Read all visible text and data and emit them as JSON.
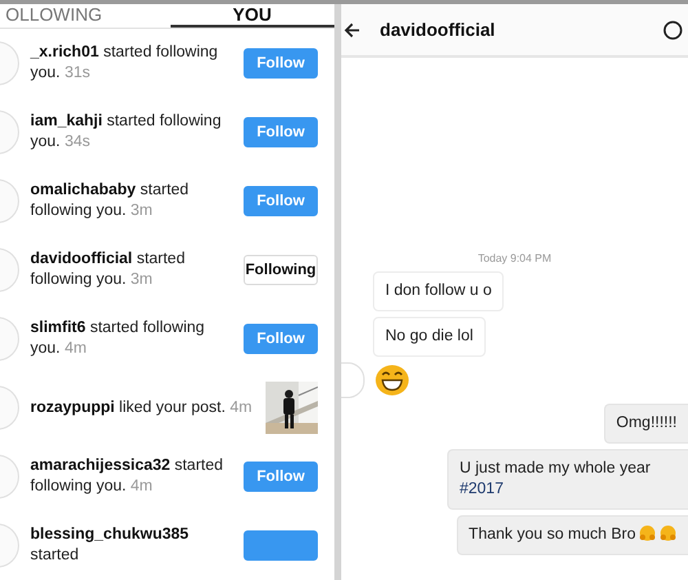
{
  "activity": {
    "tabs": [
      {
        "label": "OLLOWING",
        "selected": false
      },
      {
        "label": "YOU",
        "selected": true
      }
    ],
    "rows": [
      {
        "text": "**_x.rich01** started following you.",
        "time": "31s",
        "kind": "follow",
        "button": {
          "label": "Follow",
          "following": false
        }
      },
      {
        "text": "**iam_kahji** started following you.",
        "time": "34s",
        "kind": "follow",
        "button": {
          "label": "Follow",
          "following": false
        }
      },
      {
        "text": "**omalichababy** started following you.",
        "time": "3m",
        "kind": "follow",
        "button": {
          "label": "Follow",
          "following": false
        }
      },
      {
        "text": "**davidoofficial** started following you.",
        "time": "3m",
        "kind": "follow",
        "button": {
          "label": "Following",
          "following": true
        }
      },
      {
        "text": "**slimfit6** started following you.",
        "time": "4m",
        "kind": "follow",
        "button": {
          "label": "Follow",
          "following": false
        }
      },
      {
        "text": "**rozaypuppi** liked your post.",
        "time": "4m"
      },
      {
        "text": "**amarachijessica32** started following you.",
        "time": "4m",
        "kind": "follow",
        "button": {
          "label": "Follow",
          "following": false
        }
      },
      {
        "text": "**blessing_chukwu385** started",
        "kind": "follow",
        "button": {
          "following": false
        }
      }
    ]
  },
  "chat": {
    "title": "davidoofficial",
    "timestamp": "Today 9:04 PM",
    "messages": [
      {
        "sent": false,
        "kind": "text",
        "text": "I don follow u o"
      },
      {
        "sent": false,
        "kind": "text",
        "text": "No go die lol"
      },
      {
        "sent": false,
        "kind": "emoji",
        "avatar": true
      },
      {
        "sent": true,
        "kind": "text",
        "text": "Omg!!!!!!"
      },
      {
        "sent": true,
        "kind": "text",
        "text": "U just made my whole year",
        "hashtag": "#2017"
      },
      {
        "sent": true,
        "kind": "text",
        "text": "Thank you so much Bro",
        "emojis": [
          {
            "kind": "hug"
          },
          {
            "kind": "hug"
          }
        ]
      }
    ]
  }
}
